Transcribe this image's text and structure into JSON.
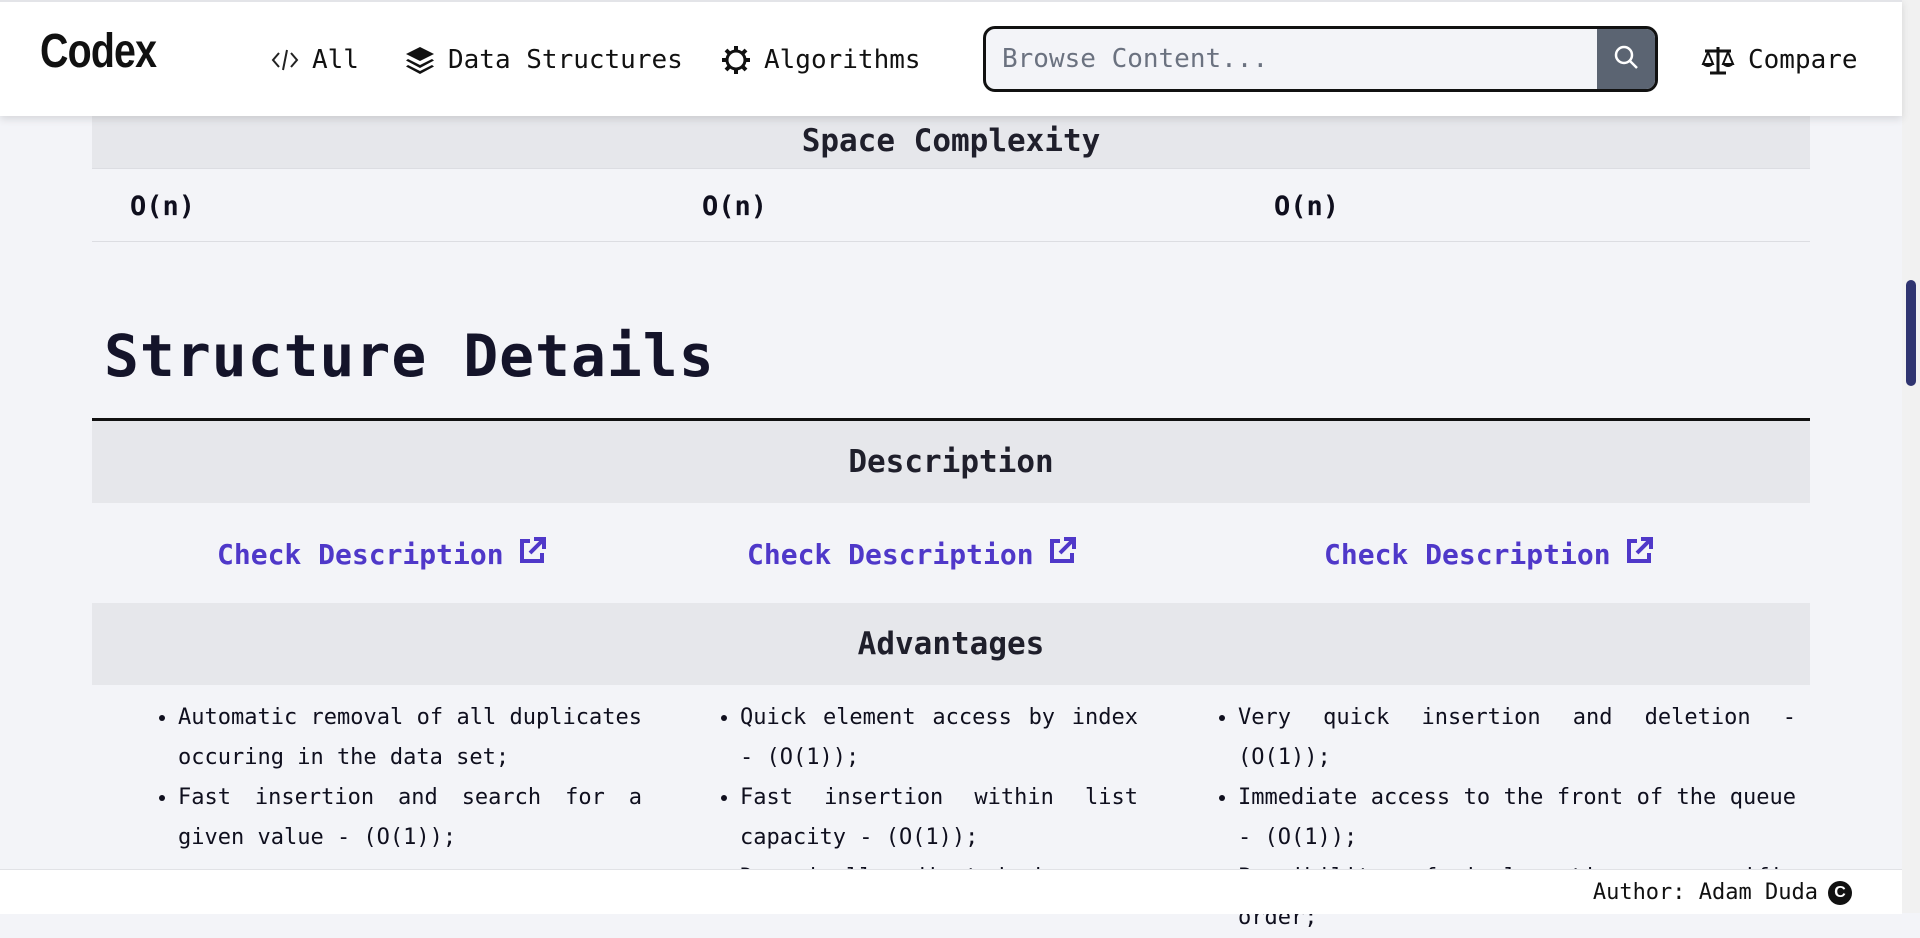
{
  "header": {
    "logo": "Codex",
    "nav": {
      "all": "All",
      "data_structures": "Data Structures",
      "algorithms": "Algorithms",
      "compare": "Compare"
    },
    "search": {
      "placeholder": "Browse Content..."
    }
  },
  "space_complexity": {
    "title": "Space Complexity",
    "values": [
      "O(n)",
      "O(n)",
      "O(n)"
    ]
  },
  "structure_details": {
    "title": "Structure Details",
    "description": {
      "title": "Description",
      "links": [
        "Check Description",
        "Check Description",
        "Check Description"
      ]
    },
    "advantages": {
      "title": "Advantages",
      "columns": [
        [
          "Automatic removal of all duplicates occuring in the data set;",
          "Fast insertion and search for a given value - (O(1));"
        ],
        [
          "Quick element access by index - (O(1));",
          "Fast insertion within list capacity - (O(1));",
          "Dynamically adjusted size;"
        ],
        [
          "Very quick insertion and deletion - (O(1));",
          "Immediate access to the front of the queue - (O(1));",
          "Possibility of implementing a specific order;"
        ]
      ]
    }
  },
  "footer": {
    "author": "Author: Adam Duda",
    "copyright_symbol": "C"
  },
  "colors": {
    "accent_link": "#4f38c9",
    "scroll_thumb": "#2f3470",
    "section_bg": "#e6e7eb"
  }
}
